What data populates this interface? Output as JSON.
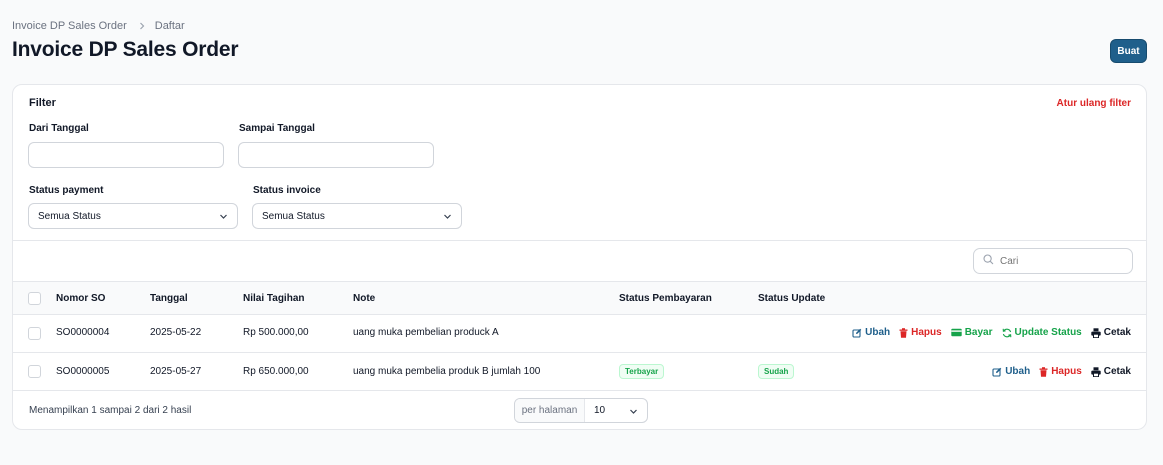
{
  "breadcrumb": {
    "parent": "Invoice DP Sales Order",
    "current": "Daftar"
  },
  "page": {
    "title": "Invoice DP Sales Order",
    "create_label": "Buat"
  },
  "filter": {
    "title": "Filter",
    "reset_label": "Atur ulang filter",
    "date_from_label": "Dari Tanggal",
    "date_from_value": "",
    "date_to_label": "Sampai Tanggal",
    "date_to_value": "",
    "payment_status_label": "Status payment",
    "payment_status_value": "Semua Status",
    "invoice_status_label": "Status invoice",
    "invoice_status_value": "Semua Status"
  },
  "search": {
    "placeholder": "Cari"
  },
  "table": {
    "columns": [
      "Nomor SO",
      "Tanggal",
      "Nilai Tagihan",
      "Note",
      "Status Pembayaran",
      "Status Update"
    ],
    "rows": [
      {
        "so": "SO0000004",
        "date": "2025-05-22",
        "amount": "Rp 500.000,00",
        "note": "uang muka pembelian produck A",
        "payment_status": "",
        "update_status": "",
        "actions": [
          "Ubah",
          "Hapus",
          "Bayar",
          "Update Status",
          "Cetak"
        ]
      },
      {
        "so": "SO0000005",
        "date": "2025-05-27",
        "amount": "Rp 650.000,00",
        "note": "uang muka pembelia produk B jumlah 100",
        "payment_status": "Terbayar",
        "update_status": "Sudah",
        "actions": [
          "Ubah",
          "Hapus",
          "Cetak"
        ]
      }
    ]
  },
  "footer": {
    "summary": "Menampilkan 1 sampai 2 dari 2 hasil",
    "per_page_label": "per halaman",
    "per_page_value": "10"
  },
  "colors": {
    "primary": "#1f5f8b",
    "danger": "#dc2626",
    "success": "#16a34a"
  }
}
